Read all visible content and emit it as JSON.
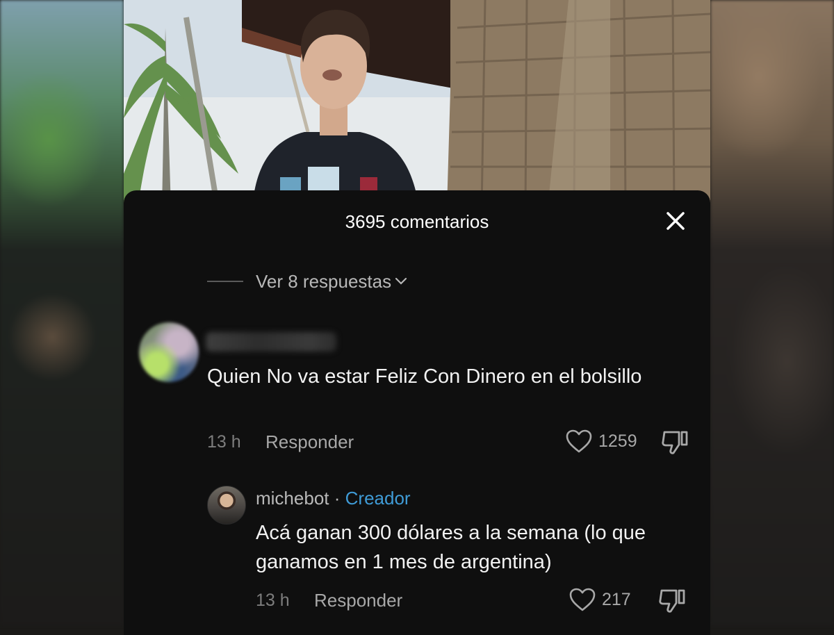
{
  "comments_header": {
    "title": "3695 comentarios",
    "close_icon": "close-icon"
  },
  "replies_toggle": {
    "label": "Ver 8 respuestas",
    "icon": "chevron-down-icon"
  },
  "comment": {
    "text": "Quien No va estar Feliz Con Dinero en el bolsillo",
    "time": "13 h",
    "reply_label": "Responder",
    "likes": "1259",
    "like_icon": "heart-icon",
    "dislike_icon": "thumbs-down-icon"
  },
  "reply": {
    "username": "michebot",
    "separator": "·",
    "badge": "Creador",
    "text": "Acá ganan 300 dólares a la semana (lo que ganamos en 1 mes de argentina)",
    "time": "13 h",
    "reply_label": "Responder",
    "likes": "217",
    "like_icon": "heart-icon",
    "dislike_icon": "thumbs-down-icon"
  },
  "colors": {
    "panel_bg": "#0f0f0f",
    "creator_badge": "#3f9bd6",
    "text_primary": "#f2f2f2",
    "text_secondary": "#a8a8a8"
  }
}
